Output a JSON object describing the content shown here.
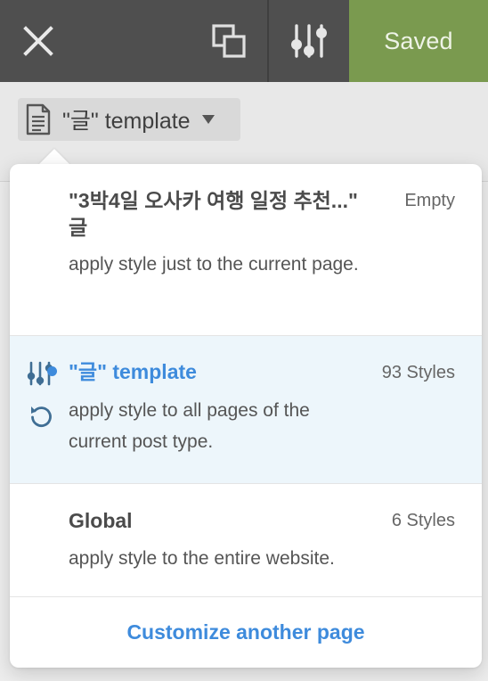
{
  "toolbar": {
    "close_icon": "close-icon",
    "view_icon": "responsive-view-icon",
    "settings_icon": "sliders-icon",
    "saved_label": "Saved",
    "saved_color": "#7a9a4f"
  },
  "template_selector": {
    "label": "\"글\" template",
    "icon": "document-icon"
  },
  "dropdown": {
    "options": [
      {
        "title": "\"3박4일 오사카 여행 일정 추천...\" 글",
        "count": "Empty",
        "description": "apply style just to the current page."
      },
      {
        "title": "\"글\" template",
        "count": "93 Styles",
        "description": "apply style to all pages of the current post type.",
        "selected": true
      },
      {
        "title": "Global",
        "count": "6 Styles",
        "description": "apply style to the entire website."
      }
    ],
    "footer_link": "Customize another page",
    "accent_color": "#3e8bdc"
  }
}
